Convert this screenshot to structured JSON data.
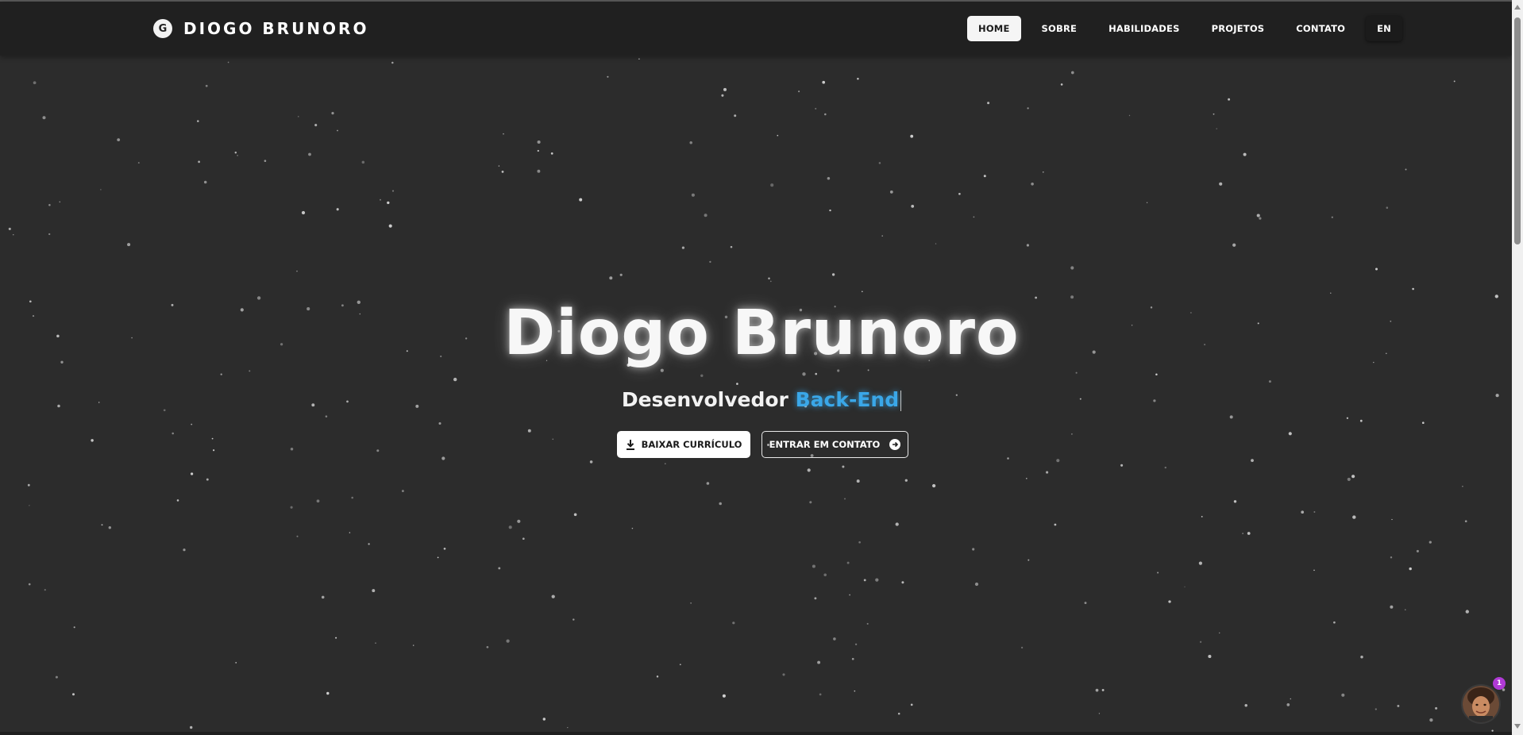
{
  "navbar": {
    "brand_logo_letter": "G",
    "brand_name": "DIOGO BRUNORO",
    "links": [
      {
        "label": "HOME",
        "active": true
      },
      {
        "label": "SOBRE",
        "active": false
      },
      {
        "label": "HABILIDADES",
        "active": false
      },
      {
        "label": "PROJETOS",
        "active": false
      },
      {
        "label": "CONTATO",
        "active": false
      }
    ],
    "language_toggle": "EN"
  },
  "hero": {
    "title": "Diogo Brunoro",
    "subtitle_prefix": "Desenvolvedor",
    "subtitle_typed": "Back-End",
    "buttons": {
      "download_cv": "BAIXAR CURRÍCULO",
      "contact": "ENTRAR EM CONTATO"
    }
  },
  "chat_widget": {
    "badge_count": "1"
  },
  "colors": {
    "background": "#2c2c2c",
    "navbar": "#202020",
    "accent_typed": "#3aa7e8",
    "badge": "#b03ad6"
  }
}
